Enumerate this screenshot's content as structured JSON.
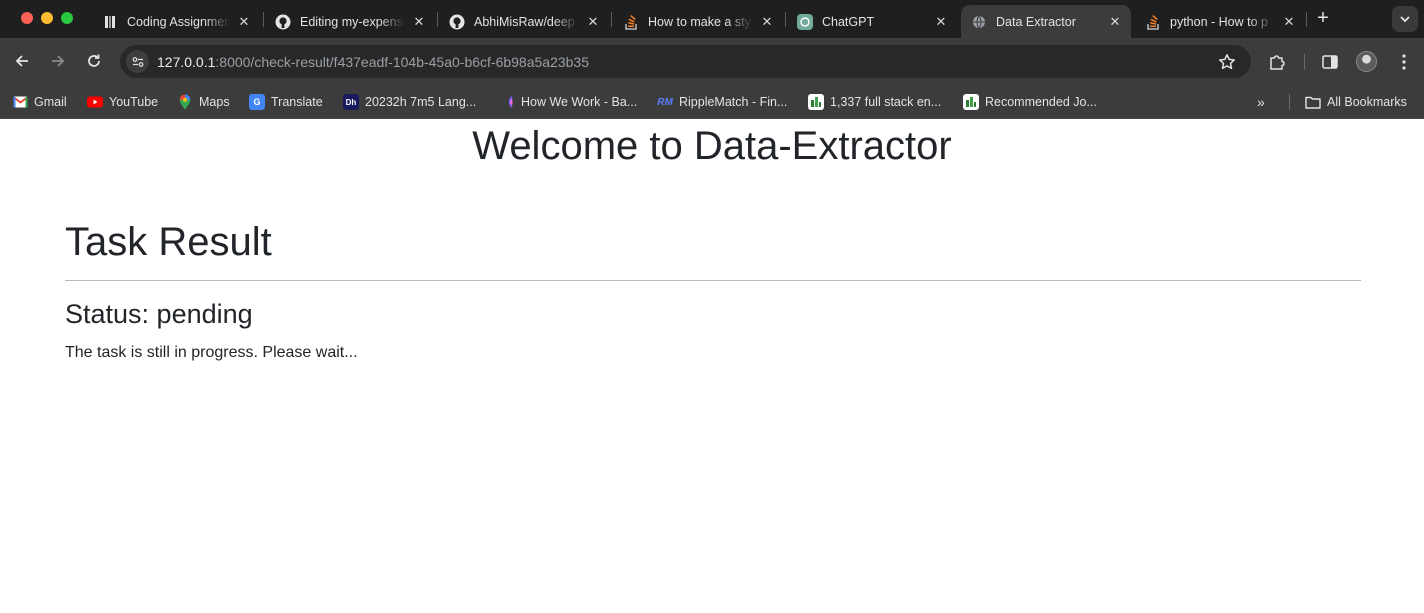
{
  "browser": {
    "tabs": [
      {
        "title": "Coding Assignment",
        "icon": "document-icon"
      },
      {
        "title": "Editing my-expense",
        "icon": "github-icon"
      },
      {
        "title": "AbhiMisRaw/deep",
        "icon": "github-icon"
      },
      {
        "title": "How to make a sty",
        "icon": "stackoverflow-icon"
      },
      {
        "title": "ChatGPT",
        "icon": "chatgpt-icon"
      },
      {
        "title": "Data Extractor",
        "icon": "globe-icon",
        "active": true
      },
      {
        "title": "python - How to p",
        "icon": "stackoverflow-icon"
      }
    ],
    "new_tab_label": "+",
    "address": {
      "host": "127.0.0.1",
      "rest": ":8000/check-result/f437eadf-104b-45a0-b6cf-6b98a5a23b35"
    },
    "bookmarks": [
      {
        "label": "Gmail",
        "icon": "gmail-icon"
      },
      {
        "label": "YouTube",
        "icon": "youtube-icon"
      },
      {
        "label": "Maps",
        "icon": "maps-icon"
      },
      {
        "label": "Translate",
        "icon": "translate-icon"
      },
      {
        "label": "20232h 7m5 Lang...",
        "icon": "dh-icon"
      },
      {
        "label": "How We Work - Ba...",
        "icon": "rainbow-icon"
      },
      {
        "label": "RippleMatch - Fin...",
        "icon": "ripplematch-icon"
      },
      {
        "label": "1,337 full stack en...",
        "icon": "jobs-icon"
      },
      {
        "label": "Recommended Jo...",
        "icon": "jobs-icon"
      }
    ],
    "bookmarks_overflow": "»",
    "all_bookmarks": "All Bookmarks"
  },
  "page": {
    "site_title": "Welcome to Data-Extractor",
    "heading": "Task Result",
    "status": "Status: pending",
    "message": "The task is still in progress. Please wait..."
  },
  "colors": {
    "tabstrip": "#1f1f1f",
    "toolbar": "#3c3c3c",
    "omnibox": "#282828",
    "text": "#212529"
  }
}
